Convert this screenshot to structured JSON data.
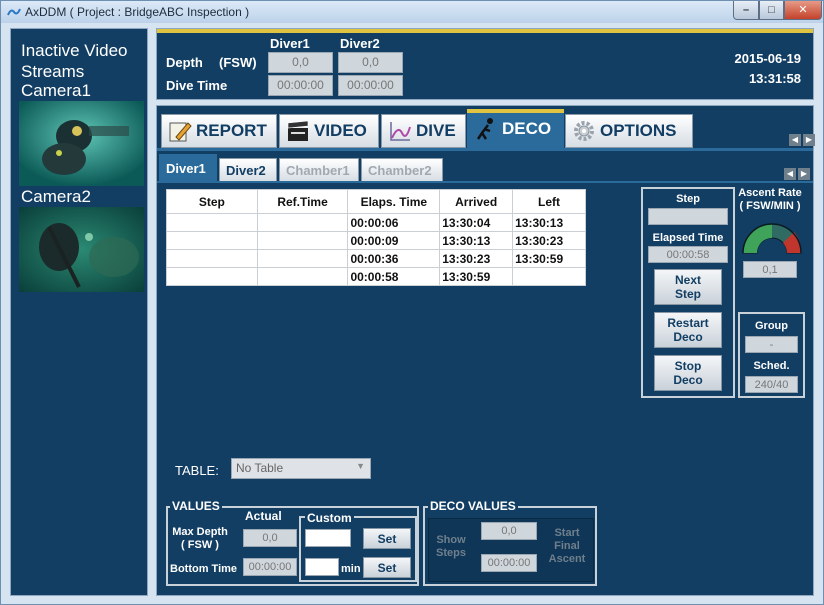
{
  "window": {
    "title": "AxDDM ( Project : BridgeABC Inspection )",
    "minimize": "–",
    "maximize": "□",
    "close": "✕"
  },
  "left_panel": {
    "heading_line1": "Inactive Video",
    "heading_line2": "Streams",
    "camera1": "Camera1",
    "camera2": "Camera2"
  },
  "header": {
    "diver1_label": "Diver1",
    "diver2_label": "Diver2",
    "depth_label": "Depth",
    "depth_unit": "(FSW)",
    "dive_time_label": "Dive Time",
    "diver1_depth": "0,0",
    "diver2_depth": "0,0",
    "diver1_time": "00:00:00",
    "diver2_time": "00:00:00",
    "date": "2015-06-19",
    "time": "13:31:58",
    "accent_color": "#e0c341"
  },
  "tabs": [
    {
      "label": "REPORT",
      "icon": "pencil-icon"
    },
    {
      "label": "VIDEO",
      "icon": "clapperboard-icon"
    },
    {
      "label": "DIVE",
      "icon": "graph-icon"
    },
    {
      "label": "DECO",
      "icon": "diver-icon",
      "active": true
    },
    {
      "label": "OPTIONS",
      "icon": "gear-icon"
    }
  ],
  "subtabs": [
    {
      "label": "Diver1",
      "state": "active"
    },
    {
      "label": "Diver2",
      "state": "normal"
    },
    {
      "label": "Chamber1",
      "state": "disabled"
    },
    {
      "label": "Chamber2",
      "state": "disabled"
    }
  ],
  "deco_table": {
    "headers": [
      "Step",
      "Ref.Time",
      "Elaps. Time",
      "Arrived",
      "Left"
    ],
    "rows": [
      [
        "",
        "",
        "00:00:06",
        "13:30:04",
        "13:30:13"
      ],
      [
        "",
        "",
        "00:00:09",
        "13:30:13",
        "13:30:23"
      ],
      [
        "",
        "",
        "00:00:36",
        "13:30:23",
        "13:30:59"
      ],
      [
        "",
        "",
        "00:00:58",
        "13:30:59",
        ""
      ]
    ]
  },
  "step_panel": {
    "step_label": "Step",
    "step_value": "",
    "elapsed_label": "Elapsed Time",
    "elapsed_value": "00:00:58",
    "next_step_line1": "Next",
    "next_step_line2": "Step",
    "restart_line1": "Restart",
    "restart_line2": "Deco",
    "stop_line1": "Stop",
    "stop_line2": "Deco"
  },
  "ascent": {
    "label_line1": "Ascent Rate",
    "label_line2": "( FSW/MIN )",
    "value": "0,1",
    "gauge_level": 0.0
  },
  "group_panel": {
    "group_label": "Group",
    "group_value": "-",
    "sched_label": "Sched.",
    "sched_value": "240/40"
  },
  "table_select": {
    "label": "TABLE:",
    "value": "No Table"
  },
  "values_group": {
    "title": "VALUES",
    "actual_label": "Actual",
    "custom_label": "Custom",
    "max_depth_line1": "Max Depth",
    "max_depth_line2": "( FSW )",
    "max_depth_actual": "0,0",
    "bottom_time_label": "Bottom Time",
    "bottom_time_actual": "00:00:00",
    "min_label": "min",
    "set_label": "Set"
  },
  "deco_values_group": {
    "title": "DECO VALUES",
    "show_steps_line1": "Show",
    "show_steps_line2": "Steps",
    "field1": "0,0",
    "field2": "00:00:00",
    "start_line1": "Start",
    "start_line2": "Final",
    "start_line3": "Ascent"
  }
}
